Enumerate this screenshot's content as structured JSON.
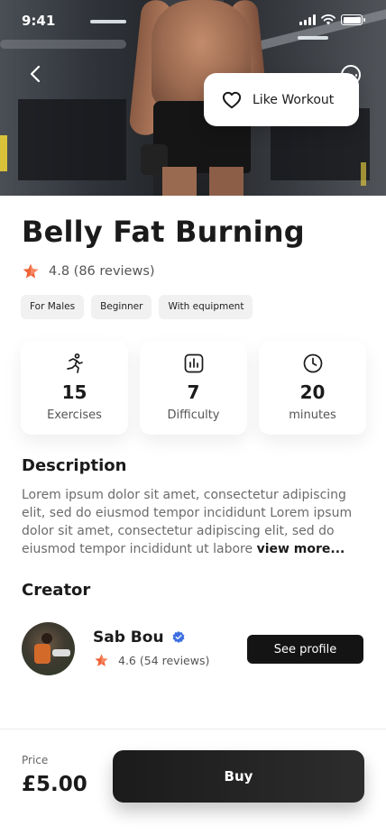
{
  "status_bar": {
    "time": "9:41"
  },
  "hero": {
    "like_label": "Like Workout"
  },
  "workout": {
    "title": "Belly Fat Burning",
    "rating": "4.8",
    "reviews": "(86 reviews)",
    "tags": [
      "For Males",
      "Beginner",
      "With equipment"
    ]
  },
  "stats": [
    {
      "icon": "running-icon",
      "value": "15",
      "label": "Exercises"
    },
    {
      "icon": "chart-icon",
      "value": "7",
      "label": "Difficulty"
    },
    {
      "icon": "clock-icon",
      "value": "20",
      "label": "minutes"
    }
  ],
  "description": {
    "heading": "Description",
    "text": "Lorem ipsum dolor sit amet, consectetur adipiscing elit, sed do eiusmod tempor incididunt Lorem ipsum dolor sit amet, consectetur adipiscing elit, sed do eiusmod tempor incididunt ut labore ",
    "more": "view more..."
  },
  "creator": {
    "heading": "Creator",
    "name": "Sab Bou",
    "rating": "4.6",
    "reviews": "(54 reviews)",
    "button": "See profile"
  },
  "purchase": {
    "price_label": "Price",
    "price": "£5.00",
    "buy_label": "Buy"
  },
  "colors": {
    "accent_star": "#f0643a",
    "verified": "#3d6fe0",
    "button_dark": "#141414"
  }
}
